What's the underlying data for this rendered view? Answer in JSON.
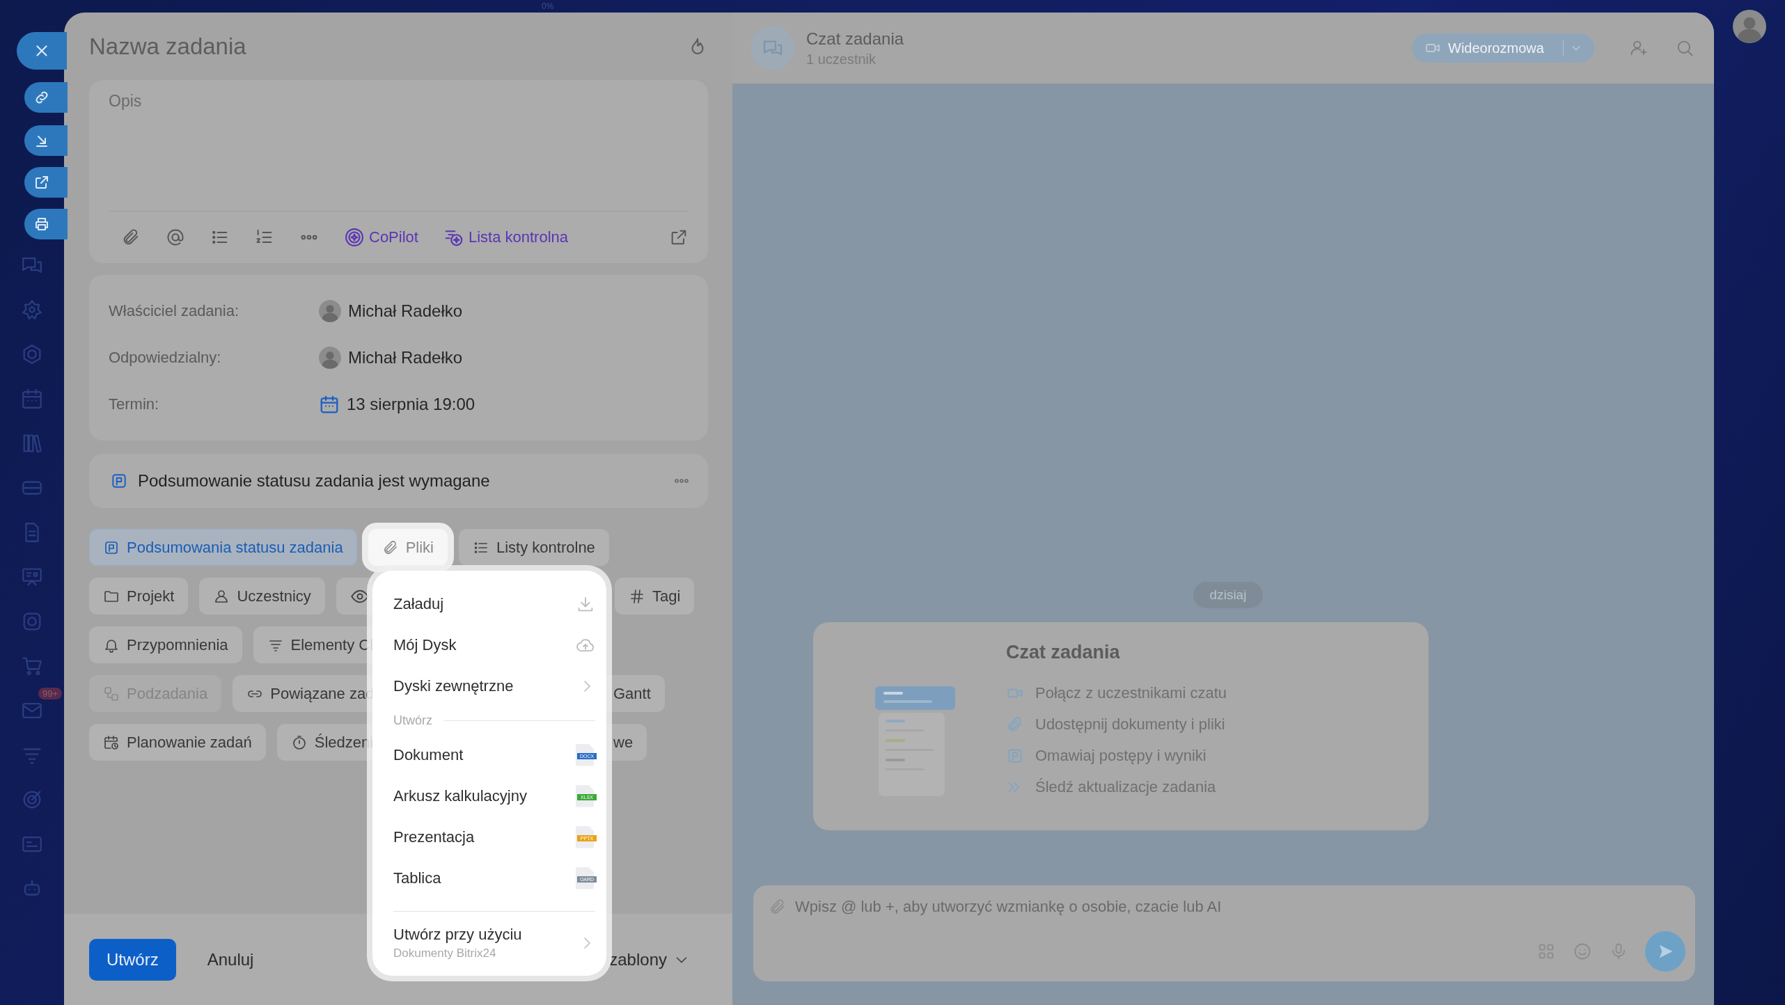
{
  "top_bar": {
    "progress": "0%"
  },
  "sidebar": {
    "badge": "99+"
  },
  "task": {
    "title": "Nazwa zadania",
    "description_placeholder": "Opis",
    "editor_tools": [
      {
        "kind": "copilot",
        "label": "CoPilot"
      },
      {
        "kind": "checklist",
        "label": "Lista kontrolna"
      }
    ],
    "fields": [
      {
        "kind": "user",
        "label": "Właściciel zadania:",
        "value": "Michał Radełko"
      },
      {
        "kind": "user",
        "label": "Odpowiedzialny:",
        "value": "Michał Radełko"
      },
      {
        "kind": "date",
        "label": "Termin:",
        "value": "13 sierpnia 19:00"
      }
    ],
    "notice": "Podsumowanie statusu zadania jest wymagane",
    "chip_rows": [
      [
        {
          "kind": "summary",
          "label": "Podsumowania statusu zadania",
          "active": true,
          "open": false,
          "disabled": false,
          "clipped_end": false,
          "clipped_start": false
        },
        {
          "kind": "files",
          "label": "Pliki",
          "active": false,
          "open": true,
          "disabled": false,
          "clipped_end": false,
          "clipped_start": false
        },
        {
          "kind": "checklists",
          "label": "Listy kontrolne",
          "active": false,
          "open": false,
          "disabled": false,
          "clipped_end": false,
          "clipped_start": false
        }
      ],
      [
        {
          "kind": "project",
          "label": "Projekt",
          "active": false,
          "open": false,
          "disabled": false,
          "clipped_end": false,
          "clipped_start": false
        },
        {
          "kind": "participants",
          "label": "Uczestnicy",
          "active": false,
          "open": false,
          "disabled": false,
          "clipped_end": false,
          "clipped_start": false
        },
        {
          "kind": "observers",
          "active": false,
          "open": false,
          "disabled": false,
          "clipped_end": true,
          "clipped_start": false
        },
        {
          "kind": "tags",
          "label": "Tagi",
          "active": false,
          "open": false,
          "disabled": false,
          "clipped_end": false,
          "clipped_start": false
        }
      ],
      [
        {
          "kind": "reminders",
          "label": "Przypomnienia",
          "active": false,
          "open": false,
          "disabled": false,
          "clipped_end": false,
          "clipped_start": false
        },
        {
          "kind": "crm",
          "label": "Elementy Cl",
          "active": false,
          "open": false,
          "disabled": false,
          "clipped_end": true,
          "clipped_start": false
        }
      ],
      [
        {
          "kind": "subtasks",
          "label": "Podzadania",
          "active": false,
          "open": false,
          "disabled": true,
          "clipped_end": false,
          "clipped_start": false
        },
        {
          "kind": "related",
          "label": "Powiązane zad",
          "active": false,
          "open": false,
          "disabled": false,
          "clipped_end": true,
          "clipped_start": false
        },
        {
          "kind": "gantt",
          "label": "Gantt",
          "active": false,
          "open": false,
          "disabled": false,
          "clipped_end": false,
          "clipped_start": true
        }
      ],
      [
        {
          "kind": "planning",
          "label": "Planowanie zadań",
          "active": false,
          "open": false,
          "disabled": false,
          "clipped_end": false,
          "clipped_start": false
        },
        {
          "kind": "tracking",
          "label": "Śledzeni",
          "active": false,
          "open": false,
          "disabled": false,
          "clipped_end": true,
          "clipped_start": false
        },
        {
          "kind": "plain",
          "label": "we",
          "active": false,
          "open": false,
          "disabled": false,
          "clipped_end": false,
          "clipped_start": true
        }
      ]
    ],
    "footer": {
      "primary": "Utwórz",
      "cancel": "Anuluj",
      "templates": "zablony"
    }
  },
  "files_menu": {
    "items": [
      {
        "kind": "upload",
        "label": "Załaduj"
      },
      {
        "kind": "drive",
        "label": "Mój Dysk"
      },
      {
        "kind": "submenu",
        "label": "Dyski zewnętrzne"
      }
    ],
    "create_heading": "Utwórz",
    "create_items": [
      {
        "label": "Dokument",
        "badge": "DOCX",
        "color": "#2b6cc4"
      },
      {
        "label": "Arkusz kalkulacyjny",
        "badge": "XLSX",
        "color": "#3aa935"
      },
      {
        "label": "Prezentacja",
        "badge": "PPTX",
        "color": "#e8a317"
      },
      {
        "label": "Tablica",
        "badge": "OARD",
        "color": "#7d8a99"
      }
    ],
    "footer_item": {
      "label": "Utwórz przy użyciu",
      "sublabel": "Dokumenty Bitrix24"
    }
  },
  "chat": {
    "title": "Czat zadania",
    "subtitle": "1 uczestnik",
    "call_button": "Wideorozmowa",
    "date_pill": "dzisiaj",
    "intro": {
      "title": "Czat zadania",
      "items": [
        {
          "kind": "video",
          "text": "Połącz z uczestnikami czatu"
        },
        {
          "kind": "attach",
          "text": "Udostępnij dokumenty i pliki"
        },
        {
          "kind": "summary",
          "text": "Omawiaj postępy i wyniki"
        },
        {
          "kind": "follow",
          "text": "Śledź aktualizacje zadania"
        }
      ]
    },
    "input_placeholder": "Wpisz @ lub +, aby utworzyć wzmiankę o osobie, czacie lub AI"
  }
}
